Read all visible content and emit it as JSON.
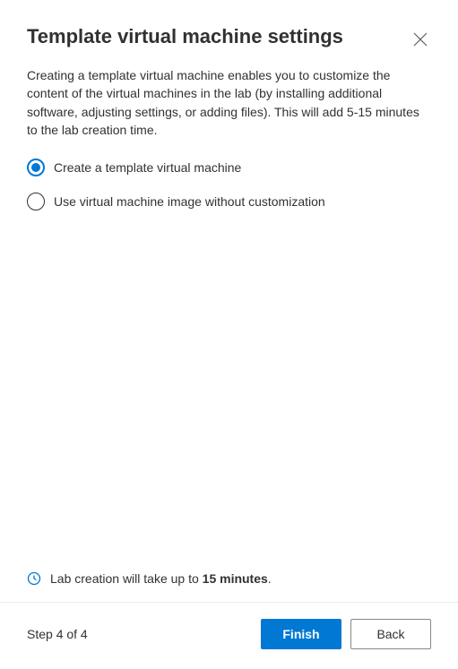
{
  "header": {
    "title": "Template virtual machine settings"
  },
  "body": {
    "description": "Creating a template virtual machine enables you to customize the content of the virtual machines in the lab (by installing additional software, adjusting settings, or adding files). This will add 5-15 minutes to the lab creation time.",
    "options": [
      {
        "label": "Create a template virtual machine",
        "selected": true
      },
      {
        "label": "Use virtual machine image without customization",
        "selected": false
      }
    ]
  },
  "info": {
    "prefix": "Lab creation will take up to ",
    "bold": "15 minutes",
    "suffix": "."
  },
  "footer": {
    "step_label": "Step 4 of 4",
    "primary_label": "Finish",
    "secondary_label": "Back"
  }
}
